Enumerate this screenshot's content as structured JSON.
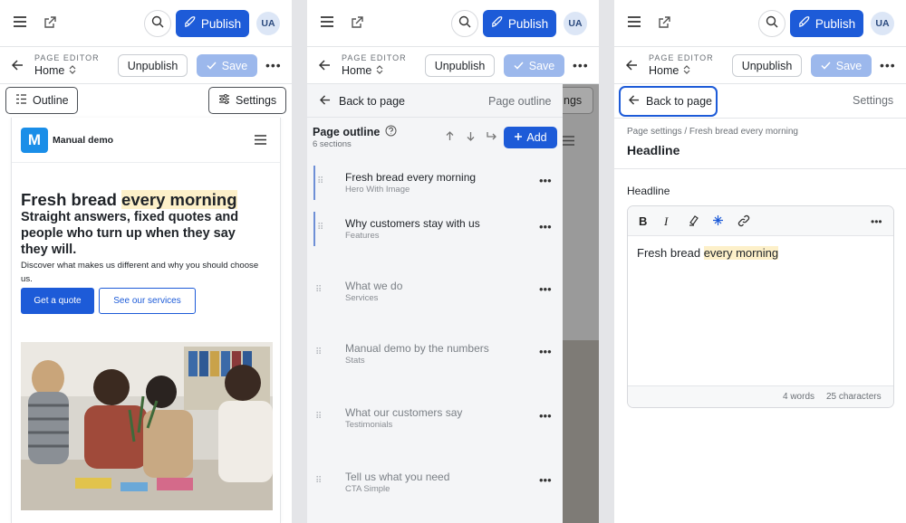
{
  "panels": [
    {
      "top": {
        "publish": "Publish",
        "avatar": "UA"
      },
      "editor": {
        "overline": "PAGE EDITOR",
        "title": "Home",
        "unpublish": "Unpublish",
        "save": "Save"
      },
      "tabs": {
        "outline": "Outline",
        "settings": "Settings"
      },
      "preview": {
        "site_logo": "M",
        "site_name": "Manual demo",
        "h1_a": "Fresh bread ",
        "h1_b": "every morning",
        "sub": "Straight answers, fixed quotes and people who turn up when they say they will.",
        "body": "Discover what makes us different and why you should choose us.",
        "cta_primary": "Get a quote",
        "cta_secondary": "See our services"
      }
    },
    {
      "top": {
        "publish": "Publish",
        "avatar": "UA"
      },
      "editor": {
        "overline": "PAGE EDITOR",
        "title": "Home",
        "unpublish": "Unpublish",
        "save": "Save"
      },
      "back": "Back to page",
      "crumb": "Page outline",
      "peek": "ngs",
      "outline_title": "Page outline",
      "outline_count": "6 sections",
      "add": "Add",
      "sections": [
        {
          "title": "Fresh bread every morning",
          "sub": "Hero With Image"
        },
        {
          "title": "Why customers stay with us",
          "sub": "Features"
        },
        {
          "title": "What we do",
          "sub": "Services"
        },
        {
          "title": "Manual demo by the numbers",
          "sub": "Stats"
        },
        {
          "title": "What our customers say",
          "sub": "Testimonials"
        },
        {
          "title": "Tell us what you need",
          "sub": "CTA Simple"
        }
      ]
    },
    {
      "top": {
        "publish": "Publish",
        "avatar": "UA"
      },
      "editor": {
        "overline": "PAGE EDITOR",
        "title": "Home",
        "unpublish": "Unpublish",
        "save": "Save"
      },
      "back": "Back to page",
      "settings": "Settings",
      "breadcrumb": "Page settings / Fresh bread every morning",
      "field_title": "Headline",
      "field_label": "Headline",
      "value_a": "Fresh bread ",
      "value_b": "every morning",
      "words": "4 words",
      "chars": "25 characters"
    }
  ],
  "colors": {
    "brand": "#1d5bd8",
    "highlight": "#fdf0c9",
    "logo": "#1a8ee8"
  }
}
